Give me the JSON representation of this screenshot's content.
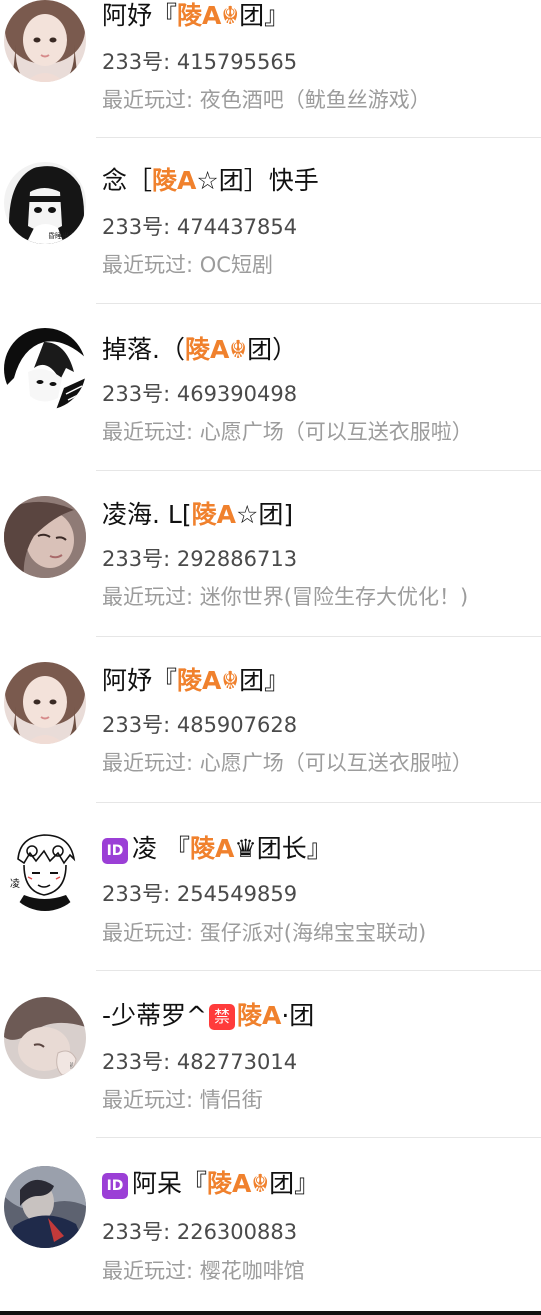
{
  "account_prefix": "233号: ",
  "recent_prefix": "最近玩过: ",
  "friends": [
    {
      "name_before": "阿妤『",
      "name_tag": "陵A☬",
      "name_after": "团』",
      "account_number": "415795565",
      "recent_game": "夜色酒吧（鱿鱼丝游戏）",
      "avatar_icon": "avatar-doll-girl-icon"
    },
    {
      "name_before": "念［",
      "name_tag": "陵A",
      "name_after": "☆团］快手",
      "account_number": "474437854",
      "recent_game": "OC短剧",
      "avatar_icon": "avatar-dark-hair-drawing-icon"
    },
    {
      "name_before": "掉落.（",
      "name_tag": "陵A☬",
      "name_after": "团）",
      "account_number": "469390498",
      "recent_game": "心愿广场（可以互送衣服啦）",
      "avatar_icon": "avatar-manga-boy-icon"
    },
    {
      "name_before": "凌海. L[",
      "name_tag": "陵A",
      "name_after": "☆团]",
      "account_number": "292886713",
      "recent_game": "迷你世界(冒险生存大优化！)",
      "avatar_icon": "avatar-photo-girl-icon"
    },
    {
      "name_before": "阿妤『",
      "name_tag": "陵A☬",
      "name_after": "团』",
      "account_number": "485907628",
      "recent_game": "心愿广场（可以互送衣服啦）",
      "avatar_icon": "avatar-doll-girl-icon"
    },
    {
      "badge": "ID",
      "name_before": "凌 『",
      "name_tag": "陵A",
      "name_after": "♛团长』",
      "account_number": "254549859",
      "recent_game": "蛋仔派对(海绵宝宝联动)",
      "avatar_icon": "avatar-sketch-boy-icon"
    },
    {
      "name_before": "-少蒂罗^",
      "ban_badge": "禁",
      "name_tag": "陵A",
      "name_after": "·团",
      "account_number": "482773014",
      "recent_game": "情侣街",
      "avatar_icon": "avatar-photo-hand-icon"
    },
    {
      "badge": "ID",
      "name_before": "阿呆『",
      "name_tag": "陵A☬",
      "name_after": "团』",
      "account_number": "226300883",
      "recent_game": "樱花咖啡馆",
      "avatar_icon": "avatar-photo-dark-icon"
    }
  ],
  "colors": {
    "tag": "#f0812d",
    "name": "#111111",
    "account": "#4a4a4a",
    "recent": "#9c9c9c",
    "divider": "#e6e6e6",
    "id_badge": "#9b3fd6",
    "ban_badge": "#ff3b3b"
  }
}
